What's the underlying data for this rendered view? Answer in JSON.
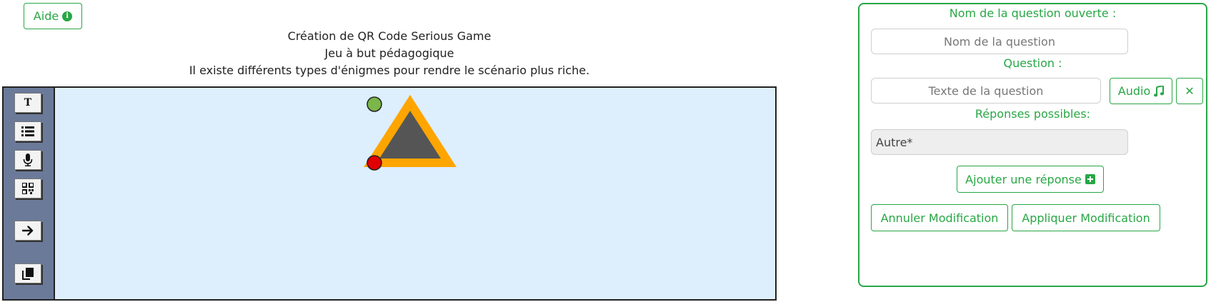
{
  "help": {
    "label": "Aide",
    "icon": "info-icon"
  },
  "header": {
    "line1": "Création de QR Code Serious Game",
    "line2": "Jeu à but pédagogique",
    "line3": "Il existe différents types d'énigmes pour rendre le scénario plus riche."
  },
  "toolbar": {
    "items": [
      {
        "name": "text-tool",
        "icon": "T"
      },
      {
        "name": "list-tool",
        "icon": "list-icon"
      },
      {
        "name": "audio-tool",
        "icon": "microphone-icon"
      },
      {
        "name": "qr-tool",
        "icon": "qrcode-icon"
      },
      {
        "name": "arrow-tool",
        "icon": "arrow-right-icon"
      },
      {
        "name": "copy-tool",
        "icon": "copy-icon"
      }
    ],
    "text_icon": "T"
  },
  "panel": {
    "name_label": "Nom de la question ouverte :",
    "name_placeholder": "Nom de la question",
    "question_label": "Question :",
    "question_placeholder": "Texte de la question",
    "audio_label": "Audio",
    "close_symbol": "✕",
    "answers_label": "Réponses possibles:",
    "answer_value": "Autre*",
    "add_answer_label": "Ajouter une réponse",
    "cancel_label": "Annuler Modification",
    "apply_label": "Appliquer Modification"
  },
  "colors": {
    "accent": "#28a745",
    "canvas_bg": "#ddeefd",
    "toolbar_bg": "#6b7a99",
    "node_outline": "#ffa500",
    "node_fill": "#555555",
    "start_dot": "#7ab648",
    "end_dot": "#e00000"
  }
}
